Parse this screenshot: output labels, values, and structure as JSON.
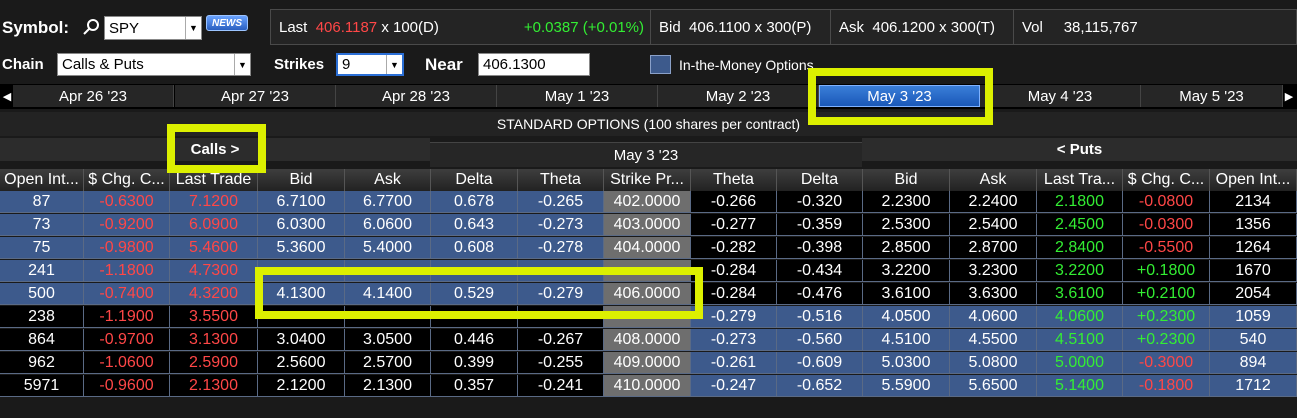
{
  "symbol": {
    "label": "Symbol:",
    "value": "SPY",
    "news_badge": "NEWS"
  },
  "chain": {
    "label": "Chain",
    "value": "Calls & Puts"
  },
  "strikes": {
    "label": "Strikes",
    "value": "9"
  },
  "near": {
    "label": "Near",
    "value": "406.1300"
  },
  "itm_checkbox": {
    "label": "In-the-Money Options"
  },
  "quote": {
    "last_label": "Last",
    "last_price": "406.1187",
    "last_size": "x 100(D)",
    "change": "+0.0387 (+0.01%)",
    "bid_label": "Bid",
    "bid": "406.1100 x 300(P)",
    "ask_label": "Ask",
    "ask": "406.1200 x 300(T)",
    "vol_label": "Vol",
    "vol": "38,115,767"
  },
  "dates": [
    "Apr 26 '23",
    "Apr 27 '23",
    "Apr 28 '23",
    "May 1 '23",
    "May 2 '23",
    "May 3 '23",
    "May 4 '23",
    "May 5 '23"
  ],
  "selected_date_index": 5,
  "standard_title": "STANDARD OPTIONS (100 shares per contract)",
  "calls_button": "Calls >",
  "puts_button": "< Puts",
  "expiry_header": "May 3 '23",
  "columns": [
    "Open Int...",
    "$ Chg. C...",
    "Last Trade",
    "Bid",
    "Ask",
    "Delta",
    "Theta",
    "Strike Pr...",
    "Theta",
    "Delta",
    "Bid",
    "Ask",
    "Last Tra...",
    "$ Chg. C...",
    "Open Int..."
  ],
  "rows": [
    {
      "c_oi": "87",
      "c_chg": "-0.6300",
      "c_last": "7.1200",
      "c_bid": "6.7100",
      "c_ask": "6.7700",
      "c_delta": "0.678",
      "c_theta": "-0.265",
      "strike": "402.0000",
      "p_theta": "-0.266",
      "p_delta": "-0.320",
      "p_bid": "2.2300",
      "p_ask": "2.2400",
      "p_last": "2.1800",
      "p_chg": "-0.0800",
      "p_oi": "2134"
    },
    {
      "c_oi": "73",
      "c_chg": "-0.9200",
      "c_last": "6.0900",
      "c_bid": "6.0300",
      "c_ask": "6.0600",
      "c_delta": "0.643",
      "c_theta": "-0.273",
      "strike": "403.0000",
      "p_theta": "-0.277",
      "p_delta": "-0.359",
      "p_bid": "2.5300",
      "p_ask": "2.5400",
      "p_last": "2.4500",
      "p_chg": "-0.0300",
      "p_oi": "1356"
    },
    {
      "c_oi": "75",
      "c_chg": "-0.9800",
      "c_last": "5.4600",
      "c_bid": "5.3600",
      "c_ask": "5.4000",
      "c_delta": "0.608",
      "c_theta": "-0.278",
      "strike": "404.0000",
      "p_theta": "-0.282",
      "p_delta": "-0.398",
      "p_bid": "2.8500",
      "p_ask": "2.8700",
      "p_last": "2.8400",
      "p_chg": "-0.5500",
      "p_oi": "1264"
    },
    {
      "c_oi": "241",
      "c_chg": "-1.1800",
      "c_last": "4.7300",
      "c_bid": "",
      "c_ask": "",
      "c_delta": "",
      "c_theta": "",
      "strike": "",
      "p_theta": "-0.284",
      "p_delta": "-0.434",
      "p_bid": "3.2200",
      "p_ask": "3.2300",
      "p_last": "3.2200",
      "p_chg": "+0.1800",
      "p_oi": "1670"
    },
    {
      "c_oi": "500",
      "c_chg": "-0.7400",
      "c_last": "4.3200",
      "c_bid": "4.1300",
      "c_ask": "4.1400",
      "c_delta": "0.529",
      "c_theta": "-0.279",
      "strike": "406.0000",
      "p_theta": "-0.284",
      "p_delta": "-0.476",
      "p_bid": "3.6100",
      "p_ask": "3.6300",
      "p_last": "3.6100",
      "p_chg": "+0.2100",
      "p_oi": "2054"
    },
    {
      "c_oi": "238",
      "c_chg": "-1.1900",
      "c_last": "3.5500",
      "c_bid": "",
      "c_ask": "",
      "c_delta": "",
      "c_theta": "",
      "strike": "",
      "p_theta": "-0.279",
      "p_delta": "-0.516",
      "p_bid": "4.0500",
      "p_ask": "4.0600",
      "p_last": "4.0600",
      "p_chg": "+0.2300",
      "p_oi": "1059"
    },
    {
      "c_oi": "864",
      "c_chg": "-0.9700",
      "c_last": "3.1300",
      "c_bid": "3.0400",
      "c_ask": "3.0500",
      "c_delta": "0.446",
      "c_theta": "-0.267",
      "strike": "408.0000",
      "p_theta": "-0.273",
      "p_delta": "-0.560",
      "p_bid": "4.5100",
      "p_ask": "4.5500",
      "p_last": "4.5100",
      "p_chg": "+0.2300",
      "p_oi": "540"
    },
    {
      "c_oi": "962",
      "c_chg": "-1.0600",
      "c_last": "2.5900",
      "c_bid": "2.5600",
      "c_ask": "2.5700",
      "c_delta": "0.399",
      "c_theta": "-0.255",
      "strike": "409.0000",
      "p_theta": "-0.261",
      "p_delta": "-0.609",
      "p_bid": "5.0300",
      "p_ask": "5.0800",
      "p_last": "5.0000",
      "p_chg": "-0.3000",
      "p_oi": "894"
    },
    {
      "c_oi": "5971",
      "c_chg": "-0.9600",
      "c_last": "2.1300",
      "c_bid": "2.1200",
      "c_ask": "2.1300",
      "c_delta": "0.357",
      "c_theta": "-0.241",
      "strike": "410.0000",
      "p_theta": "-0.247",
      "p_delta": "-0.652",
      "p_bid": "5.5900",
      "p_ask": "5.6500",
      "p_last": "5.1400",
      "p_chg": "-0.1800",
      "p_oi": "1712"
    }
  ],
  "call_itm_rows": 5,
  "put_itm_from_row": 5,
  "colors": {
    "itm": "#3d5a8c",
    "otm": "#000000",
    "negative": "#ff4747",
    "positive": "#33ee33",
    "highlight": "#dcf000",
    "selected_date": "#1a58b8"
  }
}
